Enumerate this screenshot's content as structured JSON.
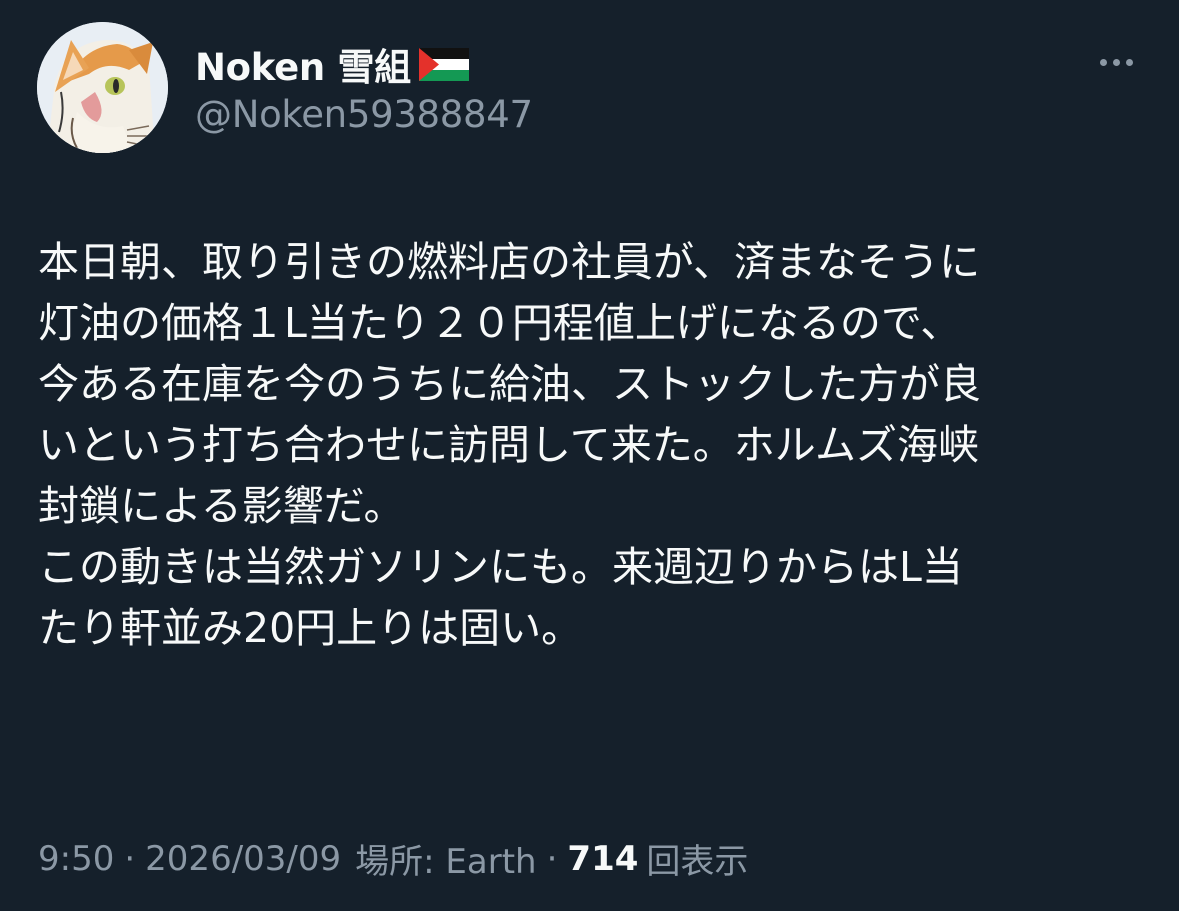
{
  "author": {
    "display_name": "Noken 雪組",
    "handle": "@Noken59388847",
    "avatar_icon": "cat-avatar-icon",
    "flag_icon": "palestine-flag-icon"
  },
  "tweet": {
    "lines": [
      "本日朝、取り引きの燃料店の社員が、済まなそうに",
      "灯油の価格１L当たり２０円程値上げになるので、",
      "今ある在庫を今のうちに給油、ストックした方が良",
      "いという打ち合わせに訪問して来た。ホルムズ海峡",
      "封鎖による影響だ。",
      "この動きは当然ガソリンにも。来週辺りからはL当",
      "たり軒並み20円上りは固い。"
    ]
  },
  "meta": {
    "time": "9:50",
    "separator": "·",
    "date": "2026/03/09",
    "location": "場所: Earth",
    "views_count": "714",
    "views_label": "回表示"
  },
  "colors": {
    "background": "#15202b",
    "text_primary": "#f7f9f9",
    "text_secondary": "#8b98a5"
  }
}
